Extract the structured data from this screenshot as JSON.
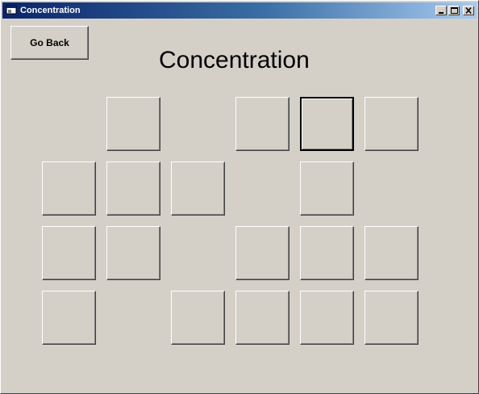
{
  "window": {
    "title": "Concentration"
  },
  "buttons": {
    "go_back": "Go Back"
  },
  "heading": "Concentration",
  "cards": {
    "rows": 4,
    "cols": 6,
    "present": [
      [
        false,
        true,
        false,
        true,
        true,
        true
      ],
      [
        true,
        true,
        true,
        false,
        true,
        false
      ],
      [
        true,
        true,
        false,
        true,
        true,
        true
      ],
      [
        true,
        false,
        true,
        true,
        true,
        true
      ]
    ],
    "focused": [
      0,
      4
    ]
  },
  "icons": {
    "app": "app-window-icon",
    "minimize": "minimize-icon",
    "maximize": "maximize-icon",
    "close": "close-icon"
  }
}
